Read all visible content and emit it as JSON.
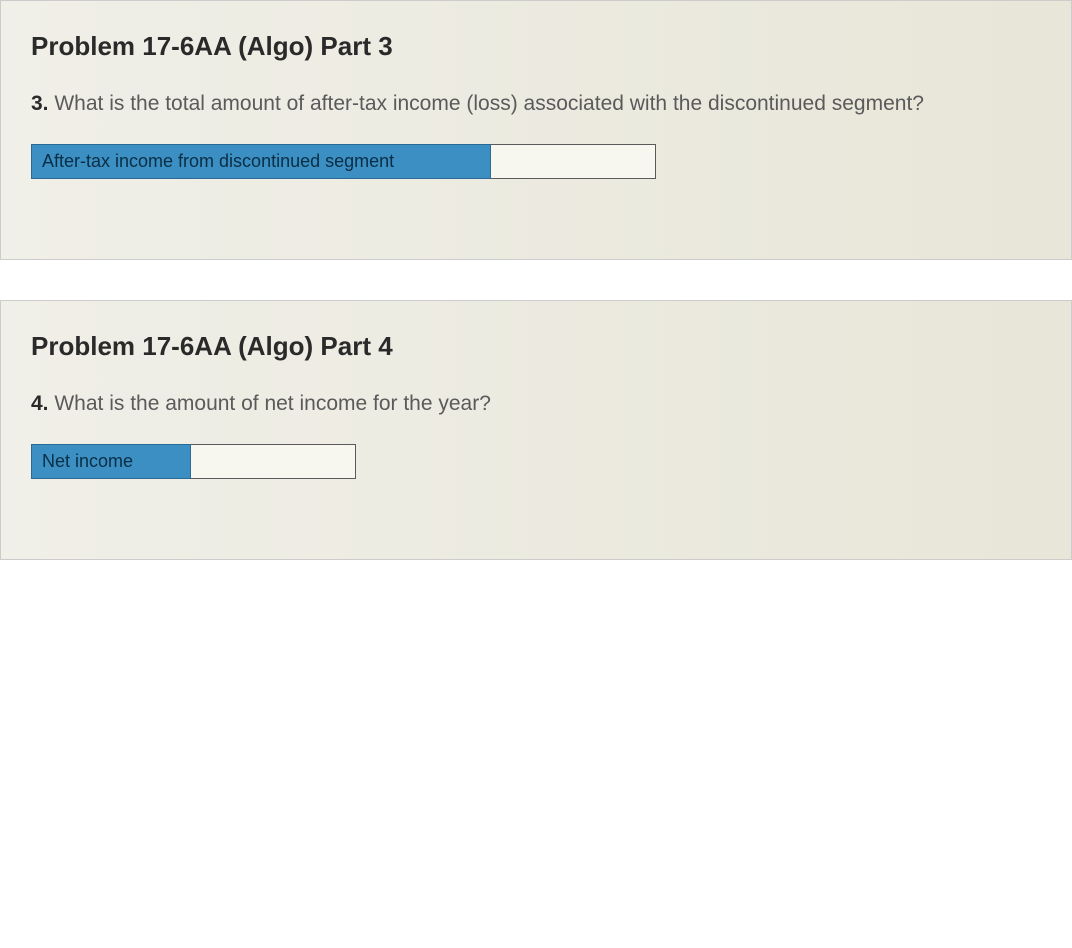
{
  "part3": {
    "title": "Problem 17-6AA (Algo) Part 3",
    "question_number": "3.",
    "question_text": " What is the total amount of after-tax income (loss) associated with the discontinued segment?",
    "field_label": "After-tax income from discontinued segment",
    "field_value": ""
  },
  "part4": {
    "title": "Problem 17-6AA (Algo) Part 4",
    "question_number": "4.",
    "question_text": " What is the amount of net income for the year?",
    "field_label": "Net income",
    "field_value": ""
  }
}
